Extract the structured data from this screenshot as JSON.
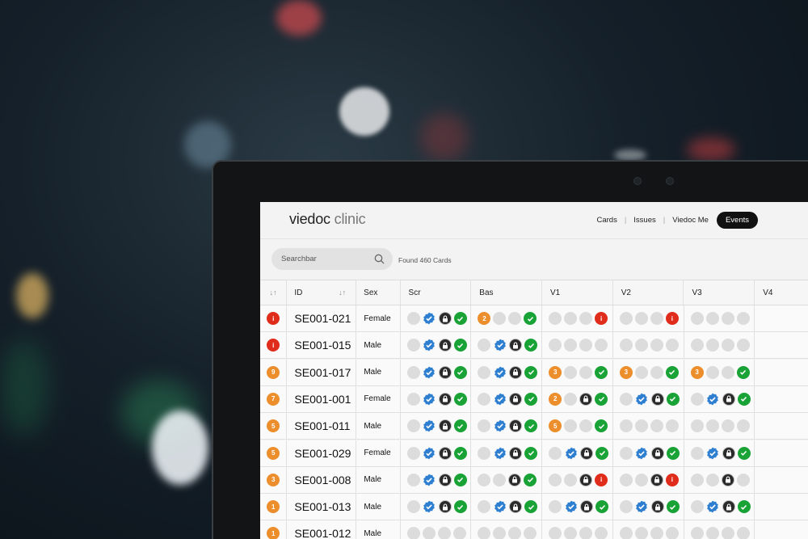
{
  "app": {
    "logo_main": "viedoc",
    "logo_sub": "clinic",
    "nav": [
      "Cards",
      "Issues",
      "Viedoc Me",
      "Events"
    ],
    "active_nav": "Events"
  },
  "search": {
    "placeholder": "Searchbar",
    "found": "Found 460 Cards"
  },
  "columns": [
    "",
    "ID",
    "Sex",
    "Scr",
    "Bas",
    "V1",
    "V2",
    "V3",
    "V4"
  ],
  "icons": {
    "e": "empty-circle-icon",
    "ok": "check-circle-icon",
    "lock": "lock-icon",
    "badge": "verified-badge-icon",
    "alert": "alert-icon",
    "num": "count-badge"
  },
  "colors": {
    "red": "#e02d1b",
    "orange": "#ec8e2c",
    "green": "#19a336",
    "blue": "#2f7fd1",
    "dark": "#2a2a2a",
    "empty": "#dcdcdc"
  },
  "rows": [
    {
      "status": "i",
      "status_color": "red",
      "id": "SE001-021",
      "sex": "Female",
      "visits": [
        [
          "e",
          "badge",
          "lock",
          "ok"
        ],
        [
          "n2",
          "e",
          "e",
          "ok"
        ],
        [
          "e",
          "e",
          "e",
          "alert"
        ],
        [
          "e",
          "e",
          "e",
          "alert"
        ],
        [
          "e",
          "e",
          "e",
          "e"
        ]
      ]
    },
    {
      "status": "i",
      "status_color": "red",
      "id": "SE001-015",
      "sex": "Male",
      "visits": [
        [
          "e",
          "badge",
          "lock",
          "ok"
        ],
        [
          "e",
          "badge",
          "lock",
          "ok"
        ],
        [
          "e",
          "e",
          "e",
          "e"
        ],
        [
          "e",
          "e",
          "e",
          "e"
        ],
        [
          "e",
          "e",
          "e",
          "e"
        ]
      ]
    },
    {
      "status": "9",
      "status_color": "orange",
      "id": "SE001-017",
      "sex": "Male",
      "visits": [
        [
          "e",
          "badge",
          "lock",
          "ok"
        ],
        [
          "e",
          "badge",
          "lock",
          "ok"
        ],
        [
          "n3",
          "e",
          "e",
          "ok"
        ],
        [
          "n3",
          "e",
          "e",
          "ok"
        ],
        [
          "n3",
          "e",
          "e",
          "ok"
        ]
      ]
    },
    {
      "status": "7",
      "status_color": "orange",
      "id": "SE001-001",
      "sex": "Female",
      "visits": [
        [
          "e",
          "badge",
          "lock",
          "ok"
        ],
        [
          "e",
          "badge",
          "lock",
          "ok"
        ],
        [
          "n2",
          "e",
          "lock",
          "ok"
        ],
        [
          "e",
          "badge",
          "lock",
          "ok"
        ],
        [
          "e",
          "badge",
          "lock",
          "ok"
        ]
      ]
    },
    {
      "status": "5",
      "status_color": "orange",
      "id": "SE001-011",
      "sex": "Male",
      "visits": [
        [
          "e",
          "badge",
          "lock",
          "ok"
        ],
        [
          "e",
          "badge",
          "lock",
          "ok"
        ],
        [
          "n5",
          "e",
          "e",
          "ok"
        ],
        [
          "e",
          "e",
          "e",
          "e"
        ],
        [
          "e",
          "e",
          "e",
          "e"
        ]
      ]
    },
    {
      "status": "5",
      "status_color": "orange",
      "id": "SE001-029",
      "sex": "Female",
      "visits": [
        [
          "e",
          "badge",
          "lock",
          "ok"
        ],
        [
          "e",
          "badge",
          "lock",
          "ok"
        ],
        [
          "e",
          "badge",
          "lock",
          "ok"
        ],
        [
          "e",
          "badge",
          "lock",
          "ok"
        ],
        [
          "e",
          "badge",
          "lock",
          "ok"
        ]
      ]
    },
    {
      "status": "3",
      "status_color": "orange",
      "id": "SE001-008",
      "sex": "Male",
      "visits": [
        [
          "e",
          "badge",
          "lock",
          "ok"
        ],
        [
          "e",
          "e",
          "lock",
          "ok"
        ],
        [
          "e",
          "e",
          "lock",
          "alert"
        ],
        [
          "e",
          "e",
          "lock",
          "alert"
        ],
        [
          "e",
          "e",
          "lock",
          "e"
        ]
      ]
    },
    {
      "status": "1",
      "status_color": "orange",
      "id": "SE001-013",
      "sex": "Male",
      "visits": [
        [
          "e",
          "badge",
          "lock",
          "ok"
        ],
        [
          "e",
          "badge",
          "lock",
          "ok"
        ],
        [
          "e",
          "badge",
          "lock",
          "ok"
        ],
        [
          "e",
          "badge",
          "lock",
          "ok"
        ],
        [
          "e",
          "badge",
          "lock",
          "ok"
        ]
      ]
    },
    {
      "status": "1",
      "status_color": "orange",
      "id": "SE001-012",
      "sex": "Male",
      "visits": [
        [
          "e",
          "e",
          "e",
          "e"
        ],
        [
          "e",
          "e",
          "e",
          "e"
        ],
        [
          "e",
          "e",
          "e",
          "e"
        ],
        [
          "e",
          "e",
          "e",
          "e"
        ],
        [
          "e",
          "e",
          "e",
          "e"
        ]
      ]
    }
  ]
}
